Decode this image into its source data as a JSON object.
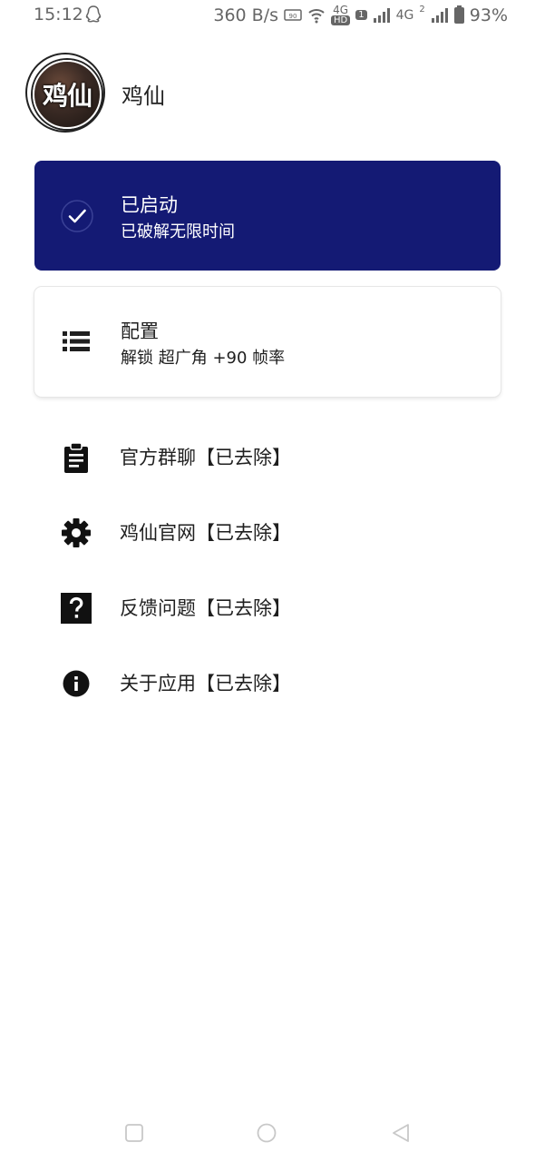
{
  "status_bar": {
    "time": "15:12",
    "speed": "360 B/s",
    "net1": "4G",
    "net1_sub": "HD",
    "sim1_badge": "1",
    "net2": "4G",
    "sim2_badge": "2",
    "battery": "93%",
    "icons": [
      "qq-icon",
      "nfc-icon",
      "wifi-icon",
      "signal-icon",
      "battery-icon"
    ]
  },
  "profile": {
    "avatar_text": "鸡仙",
    "name": "鸡仙"
  },
  "status_card": {
    "title": "已启动",
    "subtitle": "已破解无限时间",
    "icon": "check-circle-icon",
    "color": "#141a74"
  },
  "config_card": {
    "title": "配置",
    "subtitle": "解锁 超广角 +90 帧率",
    "icon": "list-icon"
  },
  "menu": [
    {
      "label": "官方群聊【已去除】",
      "icon": "clipboard-icon"
    },
    {
      "label": "鸡仙官网【已去除】",
      "icon": "gear-icon"
    },
    {
      "label": "反馈问题【已去除】",
      "icon": "help-icon"
    },
    {
      "label": "关于应用【已去除】",
      "icon": "info-icon"
    }
  ],
  "nav": [
    "recents-icon",
    "home-icon",
    "back-icon"
  ]
}
